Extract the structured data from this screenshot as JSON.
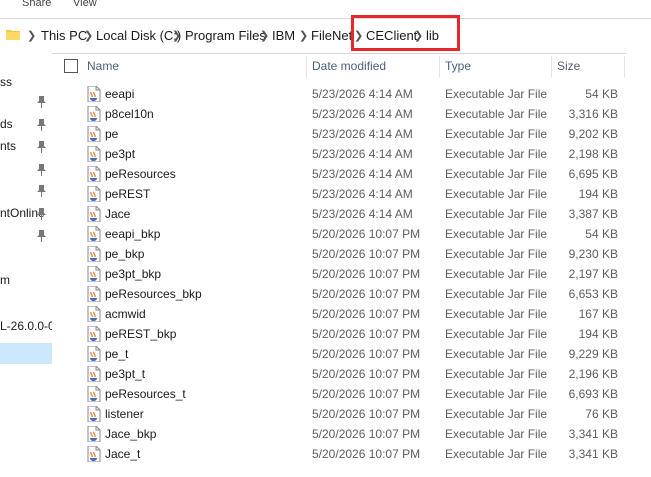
{
  "ribbon": {
    "tabs": [
      "Share",
      "View"
    ]
  },
  "breadcrumb": [
    "This PC",
    "Local Disk (C:)",
    "Program Files",
    "IBM",
    "FileNet",
    "CEClient",
    "lib"
  ],
  "nav_items": [
    "ss",
    "ds",
    "nts",
    "",
    "",
    "ntOnline",
    "",
    "m",
    "",
    "L-26.0.0-0-",
    ""
  ],
  "columns": {
    "name": "Name",
    "date": "Date modified",
    "type": "Type",
    "size": "Size"
  },
  "files": [
    {
      "name": "eeapi",
      "date": "5/23/2026 4:14 AM",
      "type": "Executable Jar File",
      "size": "54 KB"
    },
    {
      "name": "p8cel10n",
      "date": "5/23/2026 4:14 AM",
      "type": "Executable Jar File",
      "size": "3,316 KB"
    },
    {
      "name": "pe",
      "date": "5/23/2026 4:14 AM",
      "type": "Executable Jar File",
      "size": "9,202 KB"
    },
    {
      "name": "pe3pt",
      "date": "5/23/2026 4:14 AM",
      "type": "Executable Jar File",
      "size": "2,198 KB"
    },
    {
      "name": "peResources",
      "date": "5/23/2026 4:14 AM",
      "type": "Executable Jar File",
      "size": "6,695 KB"
    },
    {
      "name": "peREST",
      "date": "5/23/2026 4:14 AM",
      "type": "Executable Jar File",
      "size": "194 KB"
    },
    {
      "name": "Jace",
      "date": "5/23/2026 4:14 AM",
      "type": "Executable Jar File",
      "size": "3,387 KB"
    },
    {
      "name": "eeapi_bkp",
      "date": "5/20/2026 10:07 PM",
      "type": "Executable Jar File",
      "size": "54 KB"
    },
    {
      "name": "pe_bkp",
      "date": "5/20/2026 10:07 PM",
      "type": "Executable Jar File",
      "size": "9,230 KB"
    },
    {
      "name": "pe3pt_bkp",
      "date": "5/20/2026 10:07 PM",
      "type": "Executable Jar File",
      "size": "2,197 KB"
    },
    {
      "name": "peResources_bkp",
      "date": "5/20/2026 10:07 PM",
      "type": "Executable Jar File",
      "size": "6,653 KB"
    },
    {
      "name": "acmwid",
      "date": "5/20/2026 10:07 PM",
      "type": "Executable Jar File",
      "size": "167 KB"
    },
    {
      "name": "peREST_bkp",
      "date": "5/20/2026 10:07 PM",
      "type": "Executable Jar File",
      "size": "194 KB"
    },
    {
      "name": "pe_t",
      "date": "5/20/2026 10:07 PM",
      "type": "Executable Jar File",
      "size": "9,229 KB"
    },
    {
      "name": "pe3pt_t",
      "date": "5/20/2026 10:07 PM",
      "type": "Executable Jar File",
      "size": "2,196 KB"
    },
    {
      "name": "peResources_t",
      "date": "5/20/2026 10:07 PM",
      "type": "Executable Jar File",
      "size": "6,693 KB"
    },
    {
      "name": "listener",
      "date": "5/20/2026 10:07 PM",
      "type": "Executable Jar File",
      "size": "76 KB"
    },
    {
      "name": "Jace_bkp",
      "date": "5/20/2026 10:07 PM",
      "type": "Executable Jar File",
      "size": "3,341 KB"
    },
    {
      "name": "Jace_t",
      "date": "5/20/2026 10:07 PM",
      "type": "Executable Jar File",
      "size": "3,341 KB"
    }
  ],
  "colors": {
    "highlight": "#e5282b",
    "header_text": "#4c607a",
    "selection": "#cce8ff"
  }
}
